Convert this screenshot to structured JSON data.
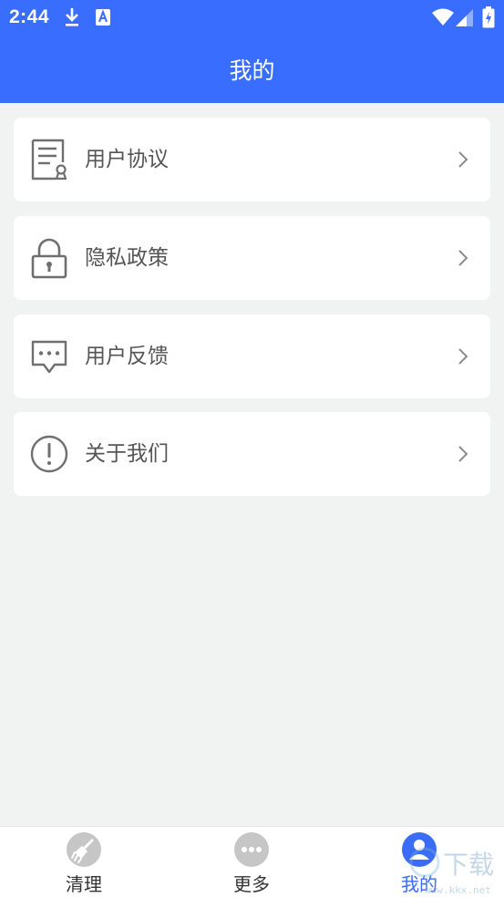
{
  "status_bar": {
    "time": "2:44",
    "left_icons": [
      "download-icon",
      "a-notification-icon"
    ],
    "right_icons": [
      "wifi-icon",
      "cellular-signal-icon",
      "battery-icon"
    ]
  },
  "header": {
    "title": "我的",
    "background": "#386dfe"
  },
  "menu": {
    "items": [
      {
        "label": "用户协议",
        "icon": "document-icon"
      },
      {
        "label": "隐私政策",
        "icon": "lock-icon"
      },
      {
        "label": "用户反馈",
        "icon": "chat-bubble-icon"
      },
      {
        "label": "关于我们",
        "icon": "info-exclamation-icon"
      }
    ]
  },
  "tabbar": {
    "tabs": [
      {
        "label": "清理",
        "icon": "broom-icon",
        "active": false
      },
      {
        "label": "更多",
        "icon": "more-dots-icon",
        "active": false
      },
      {
        "label": "我的",
        "icon": "user-icon",
        "active": true
      }
    ],
    "active_color": "#3a6cf6",
    "inactive_icon_color": "#c6c6c6"
  },
  "watermark": {
    "text": "下载",
    "site": "www.kkx.net"
  }
}
